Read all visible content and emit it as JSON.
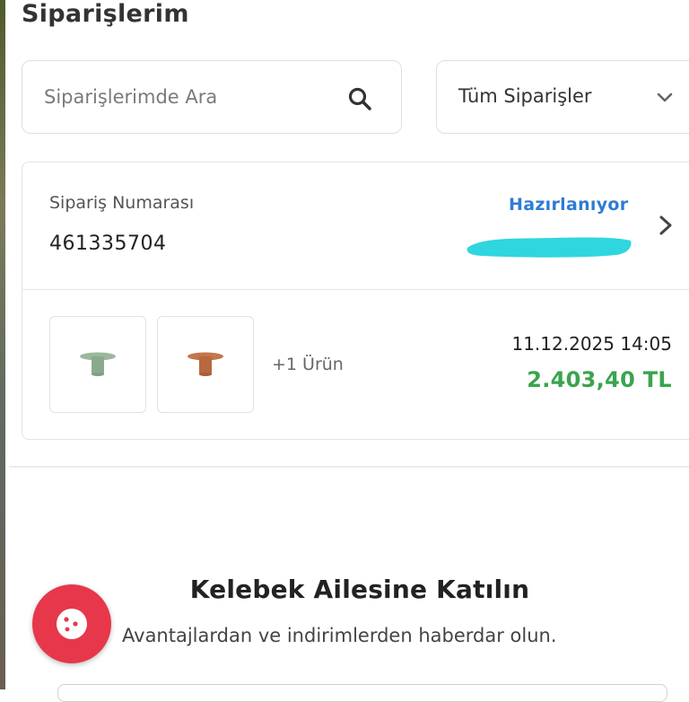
{
  "page": {
    "title": "Siparişlerim"
  },
  "search": {
    "placeholder": "Siparişlerimde Ara",
    "value": ""
  },
  "filter": {
    "selected": "Tüm Siparişler"
  },
  "order": {
    "number_label": "Sipariş Numarası",
    "number": "461335704",
    "status": "Hazırlanıyor",
    "status_color": "#2e7bd6",
    "product_thumbnails": [
      {
        "name": "green-product",
        "color": "#9bb89e"
      },
      {
        "name": "copper-product",
        "color": "#c4764c"
      }
    ],
    "more_products": "+1 Ürün",
    "date": "11.12.2025 14:05",
    "total": "2.403,40 TL",
    "total_color": "#3aa44d"
  },
  "newsletter": {
    "title": "Kelebek Ailesine Katılın",
    "subtitle": "Avantajlardan ve indirimlerden haberdar olun."
  },
  "fab": {
    "icon": "cookie-icon",
    "color": "#e7374b"
  }
}
